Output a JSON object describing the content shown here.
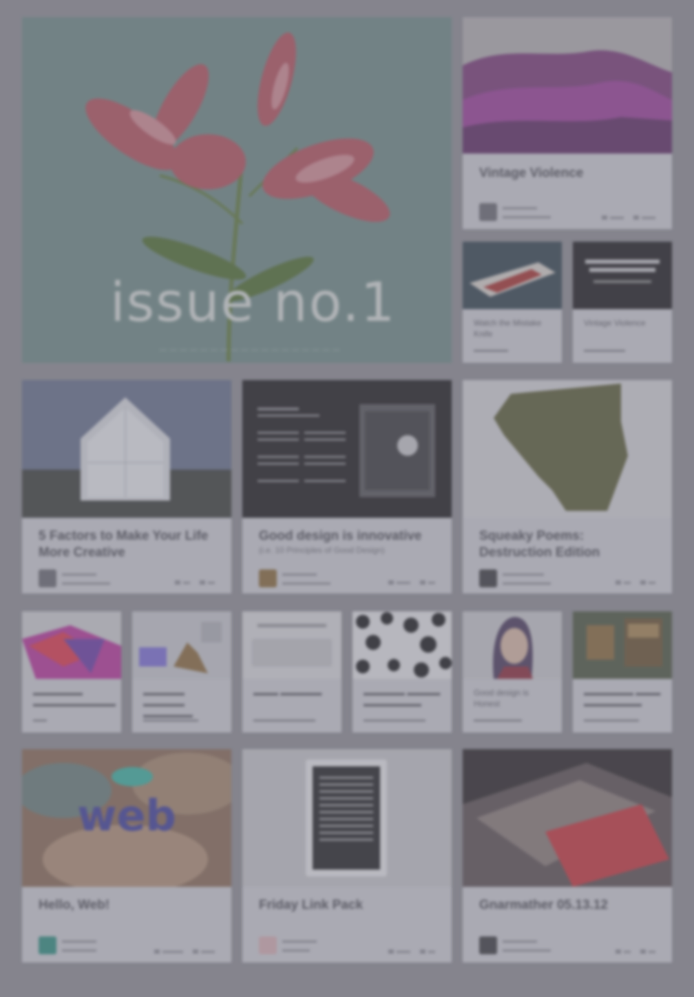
{
  "hero": {
    "caption": "issue no.1"
  },
  "cards": {
    "c1": {
      "title": "Vintage Violence"
    },
    "c2": {
      "title": "Watch the Mistake Knife",
      "author": ""
    },
    "c3": {
      "title": "Vintage Violence",
      "author": ""
    },
    "c4": {
      "title": "5 Factors to Make Your Life More Creative"
    },
    "c5": {
      "title": "Good design is innovative",
      "subtitle": "(i.e. 10 Principles of Good Design)"
    },
    "c6": {
      "title": "Squeaky Poems: Destruction Edition"
    },
    "c7": {
      "title": "Good design is Honest"
    },
    "c8": {
      "title": "Hello, Web!"
    },
    "c9": {
      "title": "Friday Link Pack"
    },
    "c10": {
      "title": "Gnarmather 05.13.12"
    }
  },
  "colors": {
    "background": "#8f8e95",
    "card": "#cfcfd6",
    "hero": "#6f8b87",
    "accent_red": "#c9343b"
  }
}
